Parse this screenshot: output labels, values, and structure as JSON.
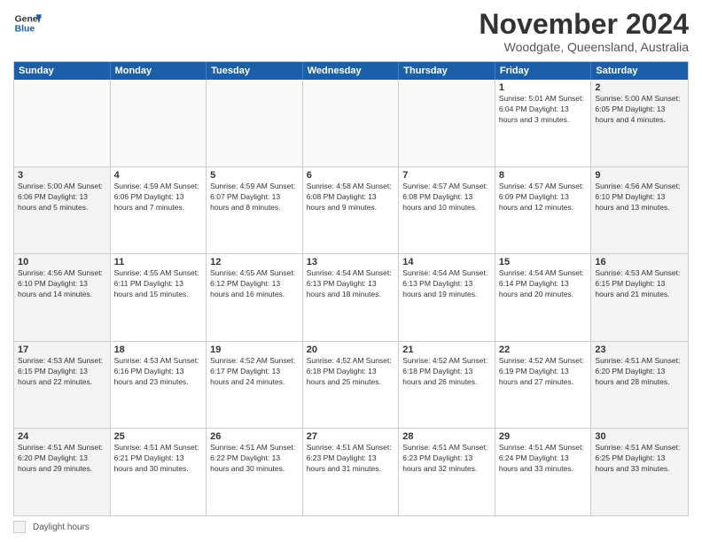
{
  "header": {
    "logo_line1": "General",
    "logo_line2": "Blue",
    "month": "November 2024",
    "location": "Woodgate, Queensland, Australia"
  },
  "weekdays": [
    "Sunday",
    "Monday",
    "Tuesday",
    "Wednesday",
    "Thursday",
    "Friday",
    "Saturday"
  ],
  "legend_label": "Daylight hours",
  "rows": [
    [
      {
        "day": "",
        "info": ""
      },
      {
        "day": "",
        "info": ""
      },
      {
        "day": "",
        "info": ""
      },
      {
        "day": "",
        "info": ""
      },
      {
        "day": "",
        "info": ""
      },
      {
        "day": "1",
        "info": "Sunrise: 5:01 AM\nSunset: 6:04 PM\nDaylight: 13 hours\nand 3 minutes."
      },
      {
        "day": "2",
        "info": "Sunrise: 5:00 AM\nSunset: 6:05 PM\nDaylight: 13 hours\nand 4 minutes."
      }
    ],
    [
      {
        "day": "3",
        "info": "Sunrise: 5:00 AM\nSunset: 6:06 PM\nDaylight: 13 hours\nand 5 minutes."
      },
      {
        "day": "4",
        "info": "Sunrise: 4:59 AM\nSunset: 6:06 PM\nDaylight: 13 hours\nand 7 minutes."
      },
      {
        "day": "5",
        "info": "Sunrise: 4:59 AM\nSunset: 6:07 PM\nDaylight: 13 hours\nand 8 minutes."
      },
      {
        "day": "6",
        "info": "Sunrise: 4:58 AM\nSunset: 6:08 PM\nDaylight: 13 hours\nand 9 minutes."
      },
      {
        "day": "7",
        "info": "Sunrise: 4:57 AM\nSunset: 6:08 PM\nDaylight: 13 hours\nand 10 minutes."
      },
      {
        "day": "8",
        "info": "Sunrise: 4:57 AM\nSunset: 6:09 PM\nDaylight: 13 hours\nand 12 minutes."
      },
      {
        "day": "9",
        "info": "Sunrise: 4:56 AM\nSunset: 6:10 PM\nDaylight: 13 hours\nand 13 minutes."
      }
    ],
    [
      {
        "day": "10",
        "info": "Sunrise: 4:56 AM\nSunset: 6:10 PM\nDaylight: 13 hours\nand 14 minutes."
      },
      {
        "day": "11",
        "info": "Sunrise: 4:55 AM\nSunset: 6:11 PM\nDaylight: 13 hours\nand 15 minutes."
      },
      {
        "day": "12",
        "info": "Sunrise: 4:55 AM\nSunset: 6:12 PM\nDaylight: 13 hours\nand 16 minutes."
      },
      {
        "day": "13",
        "info": "Sunrise: 4:54 AM\nSunset: 6:13 PM\nDaylight: 13 hours\nand 18 minutes."
      },
      {
        "day": "14",
        "info": "Sunrise: 4:54 AM\nSunset: 6:13 PM\nDaylight: 13 hours\nand 19 minutes."
      },
      {
        "day": "15",
        "info": "Sunrise: 4:54 AM\nSunset: 6:14 PM\nDaylight: 13 hours\nand 20 minutes."
      },
      {
        "day": "16",
        "info": "Sunrise: 4:53 AM\nSunset: 6:15 PM\nDaylight: 13 hours\nand 21 minutes."
      }
    ],
    [
      {
        "day": "17",
        "info": "Sunrise: 4:53 AM\nSunset: 6:15 PM\nDaylight: 13 hours\nand 22 minutes."
      },
      {
        "day": "18",
        "info": "Sunrise: 4:53 AM\nSunset: 6:16 PM\nDaylight: 13 hours\nand 23 minutes."
      },
      {
        "day": "19",
        "info": "Sunrise: 4:52 AM\nSunset: 6:17 PM\nDaylight: 13 hours\nand 24 minutes."
      },
      {
        "day": "20",
        "info": "Sunrise: 4:52 AM\nSunset: 6:18 PM\nDaylight: 13 hours\nand 25 minutes."
      },
      {
        "day": "21",
        "info": "Sunrise: 4:52 AM\nSunset: 6:18 PM\nDaylight: 13 hours\nand 26 minutes."
      },
      {
        "day": "22",
        "info": "Sunrise: 4:52 AM\nSunset: 6:19 PM\nDaylight: 13 hours\nand 27 minutes."
      },
      {
        "day": "23",
        "info": "Sunrise: 4:51 AM\nSunset: 6:20 PM\nDaylight: 13 hours\nand 28 minutes."
      }
    ],
    [
      {
        "day": "24",
        "info": "Sunrise: 4:51 AM\nSunset: 6:20 PM\nDaylight: 13 hours\nand 29 minutes."
      },
      {
        "day": "25",
        "info": "Sunrise: 4:51 AM\nSunset: 6:21 PM\nDaylight: 13 hours\nand 30 minutes."
      },
      {
        "day": "26",
        "info": "Sunrise: 4:51 AM\nSunset: 6:22 PM\nDaylight: 13 hours\nand 30 minutes."
      },
      {
        "day": "27",
        "info": "Sunrise: 4:51 AM\nSunset: 6:23 PM\nDaylight: 13 hours\nand 31 minutes."
      },
      {
        "day": "28",
        "info": "Sunrise: 4:51 AM\nSunset: 6:23 PM\nDaylight: 13 hours\nand 32 minutes."
      },
      {
        "day": "29",
        "info": "Sunrise: 4:51 AM\nSunset: 6:24 PM\nDaylight: 13 hours\nand 33 minutes."
      },
      {
        "day": "30",
        "info": "Sunrise: 4:51 AM\nSunset: 6:25 PM\nDaylight: 13 hours\nand 33 minutes."
      }
    ]
  ]
}
